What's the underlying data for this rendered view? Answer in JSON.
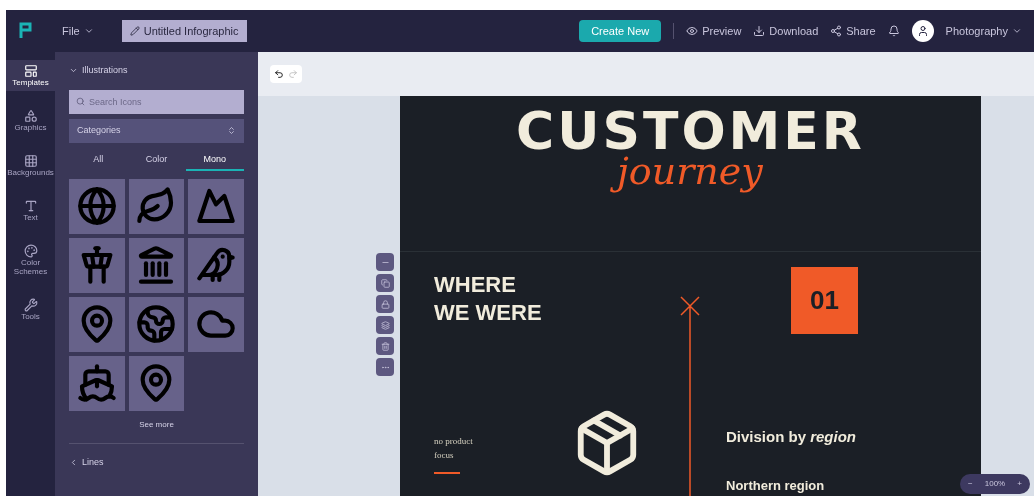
{
  "topbar": {
    "menu_label": "File",
    "doc_title": "Untitled Infographic",
    "primary_button": "Create New",
    "actions": [
      {
        "kind": "preview",
        "label": "Preview"
      },
      {
        "kind": "download",
        "label": "Download"
      },
      {
        "kind": "share",
        "label": "Share"
      }
    ],
    "user": "Photography"
  },
  "rail": [
    {
      "kind": "templates",
      "label": "Templates",
      "selected": true
    },
    {
      "kind": "graphics",
      "label": "Graphics",
      "selected": false
    },
    {
      "kind": "backgrounds",
      "label": "Backgrounds",
      "selected": false
    },
    {
      "kind": "text",
      "label": "Text",
      "selected": false
    },
    {
      "kind": "colors",
      "label": "Color Schemes",
      "selected": false
    },
    {
      "kind": "tools",
      "label": "Tools",
      "selected": false
    }
  ],
  "panel": {
    "section": "Illustrations",
    "search": {
      "placeholder": "Search Icons"
    },
    "dropdown": "Categories",
    "tabs": [
      {
        "label": "All",
        "selected": false
      },
      {
        "label": "Color",
        "selected": false
      },
      {
        "label": "Mono",
        "selected": true
      }
    ],
    "icons": [
      {
        "kind": "globe"
      },
      {
        "kind": "leaf"
      },
      {
        "kind": "mountain"
      },
      {
        "kind": "tower"
      },
      {
        "kind": "landmark"
      },
      {
        "kind": "bird"
      },
      {
        "kind": "pin"
      },
      {
        "kind": "earth"
      },
      {
        "kind": "cloud"
      },
      {
        "kind": "ship"
      },
      {
        "kind": "pin"
      }
    ],
    "more": "See more",
    "next_section": "Lines"
  },
  "document": {
    "title": "CUSTOMER",
    "subtitle": "journey",
    "heading": "WHERE\nWE WERE",
    "note": "no product\nfocus",
    "number": "01",
    "division": "Division by *region*",
    "region": "Northern region"
  },
  "zoom": {
    "value": "100%",
    "minus": "−",
    "plus": "+"
  }
}
